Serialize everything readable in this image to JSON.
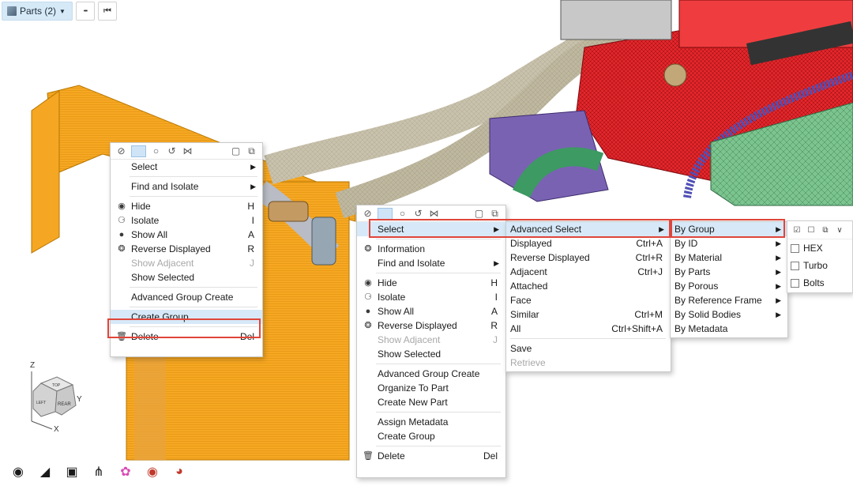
{
  "toolbar": {
    "parts_label": "Parts (2)",
    "more_label": "•••",
    "collapse_label": "⏮"
  },
  "axes": {
    "z": "Z",
    "x": "X",
    "y": "Y",
    "cube_front": "REAR",
    "cube_top": "TOP",
    "cube_left": "LEFT"
  },
  "menu_left": {
    "items": {
      "select": "Select",
      "find_isolate": "Find and Isolate",
      "hide": "Hide",
      "hide_key": "H",
      "isolate": "Isolate",
      "isolate_key": "I",
      "show_all": "Show All",
      "show_all_key": "A",
      "reverse": "Reverse Displayed",
      "reverse_key": "R",
      "show_adjacent": "Show Adjacent",
      "show_adjacent_key": "J",
      "show_selected": "Show Selected",
      "adv_group": "Advanced Group Create",
      "create_group": "Create Group",
      "delete": "Delete",
      "delete_key": "Del"
    }
  },
  "menu_main": {
    "items": {
      "select": "Select",
      "information": "Information",
      "find_isolate": "Find and Isolate",
      "hide": "Hide",
      "hide_key": "H",
      "isolate": "Isolate",
      "isolate_key": "I",
      "show_all": "Show All",
      "show_all_key": "A",
      "reverse": "Reverse Displayed",
      "reverse_key": "R",
      "show_adjacent": "Show Adjacent",
      "show_adjacent_key": "J",
      "show_selected": "Show Selected",
      "adv_group": "Advanced Group Create",
      "organize": "Organize To Part",
      "create_part": "Create New Part",
      "assign_meta": "Assign Metadata",
      "create_group": "Create Group",
      "delete": "Delete",
      "delete_key": "Del"
    }
  },
  "menu_select": {
    "items": {
      "advanced": "Advanced Select",
      "displayed": "Displayed",
      "displayed_key": "Ctrl+A",
      "reverse": "Reverse Displayed",
      "reverse_key": "Ctrl+R",
      "adjacent": "Adjacent",
      "adjacent_key": "Ctrl+J",
      "attached": "Attached",
      "face": "Face",
      "similar": "Similar",
      "similar_key": "Ctrl+M",
      "all": "All",
      "all_key": "Ctrl+Shift+A",
      "save": "Save",
      "retrieve": "Retrieve"
    }
  },
  "menu_advanced": {
    "items": {
      "by_group": "By Group",
      "by_id": "By ID",
      "by_material": "By Material",
      "by_parts": "By Parts",
      "by_porous": "By Porous",
      "by_ref_frame": "By Reference Frame",
      "by_solid": "By Solid Bodies",
      "by_metadata": "By Metadata"
    }
  },
  "group_panel": {
    "groups": [
      "HEX",
      "Turbo",
      "Bolts"
    ]
  },
  "colors": {
    "radiator": "#f5a623",
    "engine_red": "#e4262b",
    "hose": "#c8c1ab",
    "green": "#6fba85",
    "menu_highlight": "#d7e9f8",
    "callout": "#e0453a"
  }
}
